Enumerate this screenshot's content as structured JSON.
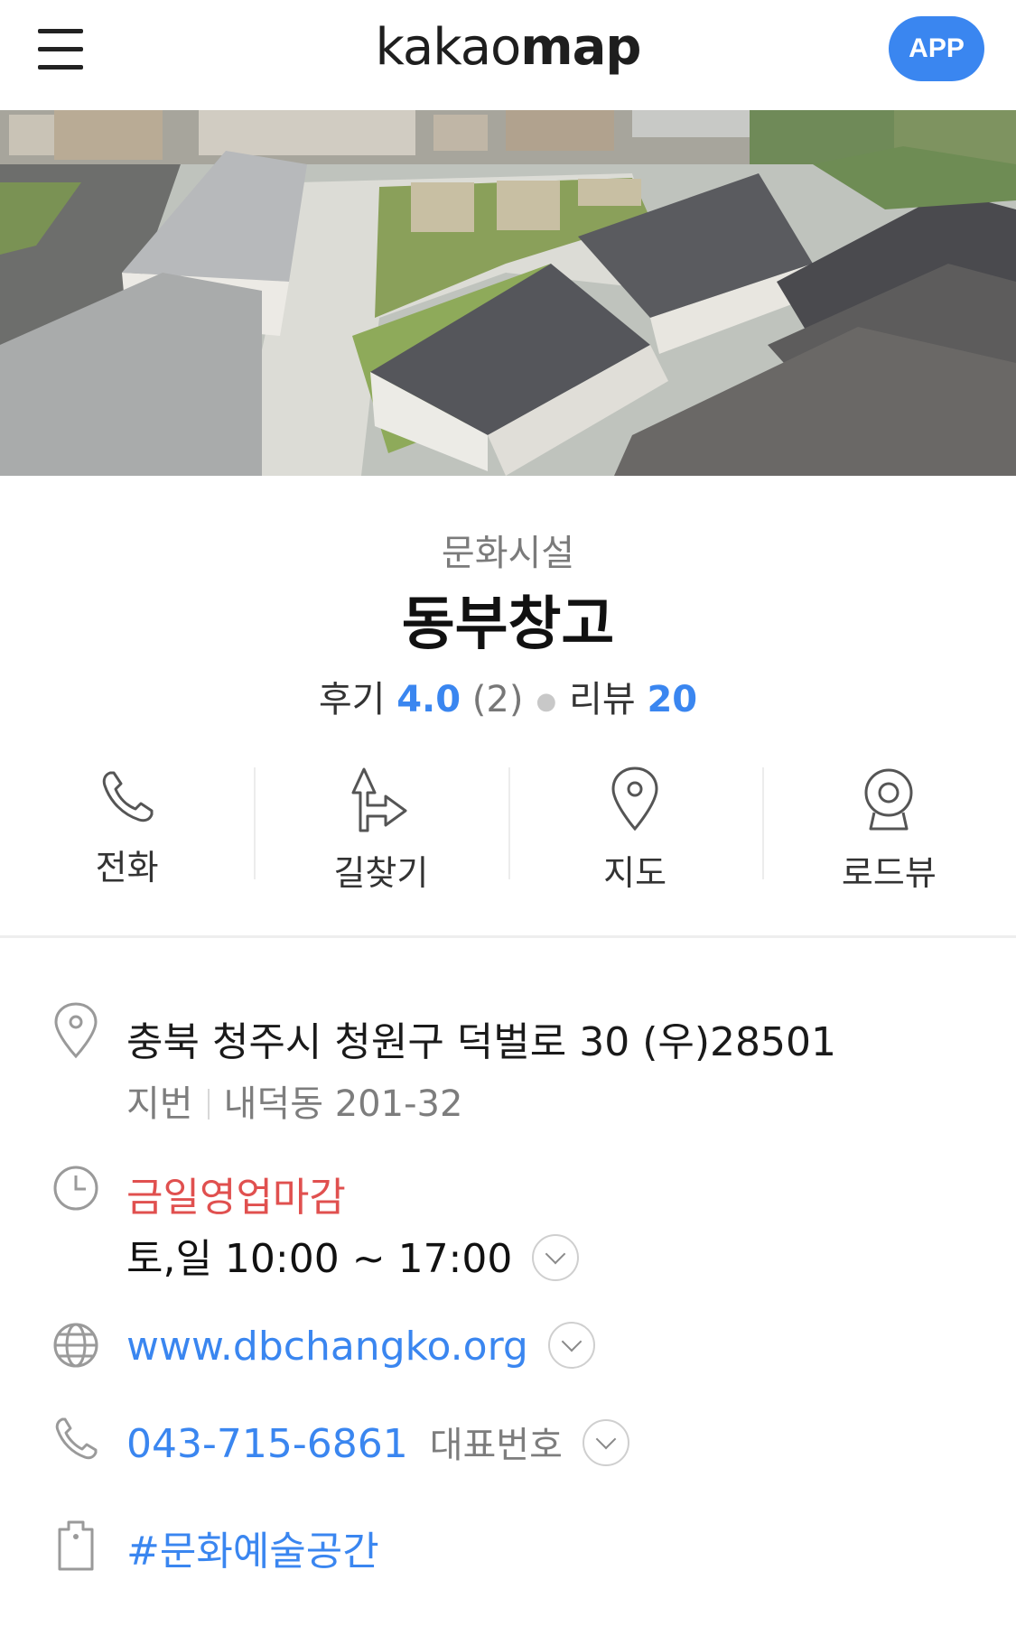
{
  "header": {
    "logo_part1": "kakao",
    "logo_part2": "map",
    "app_button": "APP"
  },
  "place": {
    "category": "문화시설",
    "name": "동부창고",
    "review_label": "후기",
    "review_score": "4.0",
    "review_count": "(2)",
    "blog_label": "리뷰",
    "blog_count": "20"
  },
  "actions": [
    {
      "label": "전화",
      "icon": "phone-icon"
    },
    {
      "label": "길찾기",
      "icon": "directions-icon"
    },
    {
      "label": "지도",
      "icon": "map-pin-icon"
    },
    {
      "label": "로드뷰",
      "icon": "roadview-icon"
    }
  ],
  "info": {
    "address": "충북 청주시 청원구 덕벌로 30 (우)28501",
    "jibun_label": "지번",
    "jibun_value": "내덕동 201-32",
    "status": "금일영업마감",
    "hours": "토,일 10:00 ~ 17:00",
    "website": "www.dbchangko.org",
    "phone": "043-715-6861",
    "phone_label": "대표번호",
    "tag": "#문화예술공간"
  },
  "colors": {
    "accent": "#3a86f0",
    "closed": "#e0504f"
  }
}
